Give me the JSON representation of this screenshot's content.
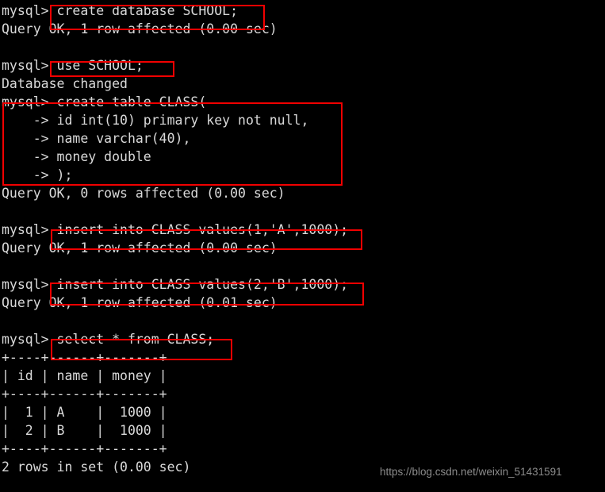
{
  "terminal": {
    "prompt": "mysql>",
    "continuation": "    ->",
    "foreground_color": "#d9d9d9",
    "background_color": "#000000",
    "lines": [
      "mysql> create database SCHOOL;",
      "Query OK, 1 row affected (0.00 sec)",
      "",
      "mysql> use SCHOOL;",
      "Database changed",
      "mysql> create table CLASS(",
      "    -> id int(10) primary key not null,",
      "    -> name varchar(40),",
      "    -> money double",
      "    -> );",
      "Query OK, 0 rows affected (0.00 sec)",
      "",
      "mysql> insert into CLASS values(1,'A',1000);",
      "Query OK, 1 row affected (0.00 sec)",
      "",
      "mysql> insert into CLASS values(2,'B',1000);",
      "Query OK, 1 row affected (0.01 sec)",
      "",
      "mysql> select * from CLASS;",
      "+----+------+-------+",
      "| id | name | money |",
      "+----+------+-------+",
      "|  1 | A    |  1000 |",
      "|  2 | B    |  1000 |",
      "+----+------+-------+",
      "2 rows in set (0.00 sec)"
    ],
    "commands": [
      "create database SCHOOL;",
      "use SCHOOL;",
      "create table CLASS(",
      "id int(10) primary key not null,",
      "name varchar(40),",
      "money double",
      ");",
      "insert into CLASS values(1,'A',1000);",
      "insert into CLASS values(2,'B',1000);",
      "select * from CLASS;"
    ],
    "messages": [
      "Query OK, 1 row affected (0.00 sec)",
      "Database changed",
      "Query OK, 0 rows affected (0.00 sec)",
      "Query OK, 1 row affected (0.00 sec)",
      "Query OK, 1 row affected (0.01 sec)",
      "2 rows in set (0.00 sec)"
    ],
    "result_table": {
      "columns": [
        "id",
        "name",
        "money"
      ],
      "rows": [
        [
          "1",
          "A",
          "1000"
        ],
        [
          "2",
          "B",
          "1000"
        ]
      ],
      "row_count_text": "2 rows in set (0.00 sec)"
    }
  },
  "annotations": {
    "color": "#f10000",
    "boxes": [
      {
        "label": "create-database-statement",
        "target": "create database SCHOOL;"
      },
      {
        "label": "use-database-statement",
        "target": "use SCHOOL;"
      },
      {
        "label": "create-table-statement",
        "target": "create table CLASS( ... );"
      },
      {
        "label": "first-insert-statement",
        "target": "insert into CLASS values(1,'A',1000);"
      },
      {
        "label": "second-insert-statement",
        "target": "insert into CLASS values(2,'B',1000);"
      },
      {
        "label": "select-statement",
        "target": "select * from CLASS;"
      }
    ]
  },
  "watermark": {
    "text": "https://blog.csdn.net/weixin_51431591",
    "color": "#8b8b8b"
  }
}
